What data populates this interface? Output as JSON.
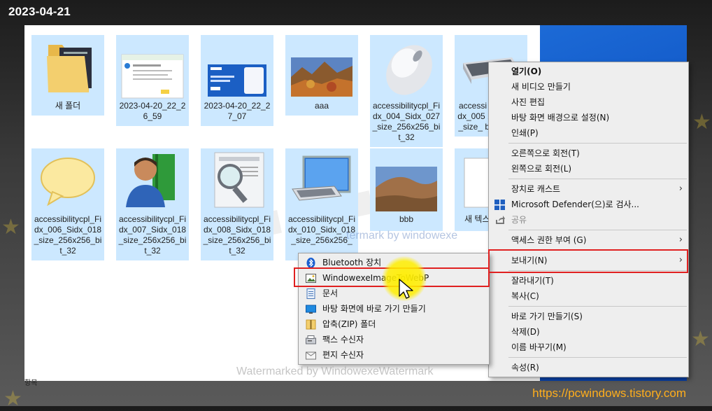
{
  "date_label": "2023-04-21",
  "blog_url": "https://pcwindows.tistory.com",
  "status_text": "항목",
  "watermark_main": "Watermarked by WindowexeWatermark",
  "watermark_inner": "termark by windowexe",
  "colors": {
    "selection": "#cce8ff",
    "highlight_red": "#e02020",
    "url_orange": "#ffae1c",
    "cursor_yellow": "#ffee00"
  },
  "files": [
    {
      "name": "새 폴더",
      "icon": "folder-icon"
    },
    {
      "name": "2023-04-20_22_26_59",
      "icon": "screenshot-thumbnail"
    },
    {
      "name": "2023-04-20_22_27_07",
      "icon": "screenshot-thumbnail"
    },
    {
      "name": "aaa",
      "icon": "landscape-thumbnail"
    },
    {
      "name": "accessibilitycpl_Fidx_004_Sidx_027_size_256x256_bit_32",
      "icon": "mouse-icon"
    },
    {
      "name": "accessi idx_005 1_size_ bi",
      "icon": "keyboard-icon"
    },
    {
      "name": "accessibilitycpl_Fidx_006_Sidx_018_size_256x256_bit_32",
      "icon": "speech-bubble-icon"
    },
    {
      "name": "accessibilitycpl_Fidx_007_Sidx_018_size_256x256_bit_32",
      "icon": "user-book-icon"
    },
    {
      "name": "accessibilitycpl_Fidx_008_Sidx_018_size_256x256_bit_32",
      "icon": "magnifier-icon"
    },
    {
      "name": "accessibilitycpl_Fidx_010_Sidx_018_size_256x256_",
      "icon": "computer-icon"
    },
    {
      "name": "bbb",
      "icon": "landscape-thumbnail"
    },
    {
      "name": "새 텍스",
      "icon": "text-file-icon"
    }
  ],
  "context_menu": {
    "items": [
      {
        "label": "열기(O)",
        "bold": true
      },
      {
        "label": "새 비디오 만들기"
      },
      {
        "label": "사진 편집"
      },
      {
        "label": "바탕 화면 배경으로 설정(N)"
      },
      {
        "label": "인쇄(P)"
      },
      {
        "sep": true
      },
      {
        "label": "오른쪽으로 회전(T)"
      },
      {
        "label": "왼쪽으로 회전(L)"
      },
      {
        "sep": true
      },
      {
        "label": "장치로 캐스트",
        "arrow": true
      },
      {
        "label": "Microsoft Defender(으)로 검사...",
        "icon": "defender-icon"
      },
      {
        "label": "공유",
        "icon": "share-icon",
        "disabled": true
      },
      {
        "sep": true
      },
      {
        "label": "액세스 권한 부여 (G)",
        "arrow": true
      },
      {
        "sep": true
      },
      {
        "label": "보내기(N)",
        "arrow": true,
        "highlight": true
      },
      {
        "sep": true
      },
      {
        "label": "잘라내기(T)"
      },
      {
        "label": "복사(C)"
      },
      {
        "sep": true
      },
      {
        "label": "바로 가기 만들기(S)"
      },
      {
        "label": "삭제(D)"
      },
      {
        "label": "이름 바꾸기(M)"
      },
      {
        "sep": true
      },
      {
        "label": "속성(R)"
      }
    ],
    "arrow_glyph": "›"
  },
  "send_to_menu": {
    "items": [
      {
        "label": "Bluetooth 장치",
        "icon": "bluetooth-icon"
      },
      {
        "label": "WindowexeImageToWebP",
        "icon": "image-app-icon",
        "highlight": true
      },
      {
        "label": "문서",
        "icon": "documents-icon"
      },
      {
        "label": "바탕 화면에 바로 가기 만들기",
        "icon": "desktop-icon"
      },
      {
        "label": "압축(ZIP) 폴더",
        "icon": "zip-folder-icon"
      },
      {
        "label": "팩스 수신자",
        "icon": "fax-icon"
      },
      {
        "label": "편지 수신자",
        "icon": "mail-icon"
      }
    ]
  }
}
